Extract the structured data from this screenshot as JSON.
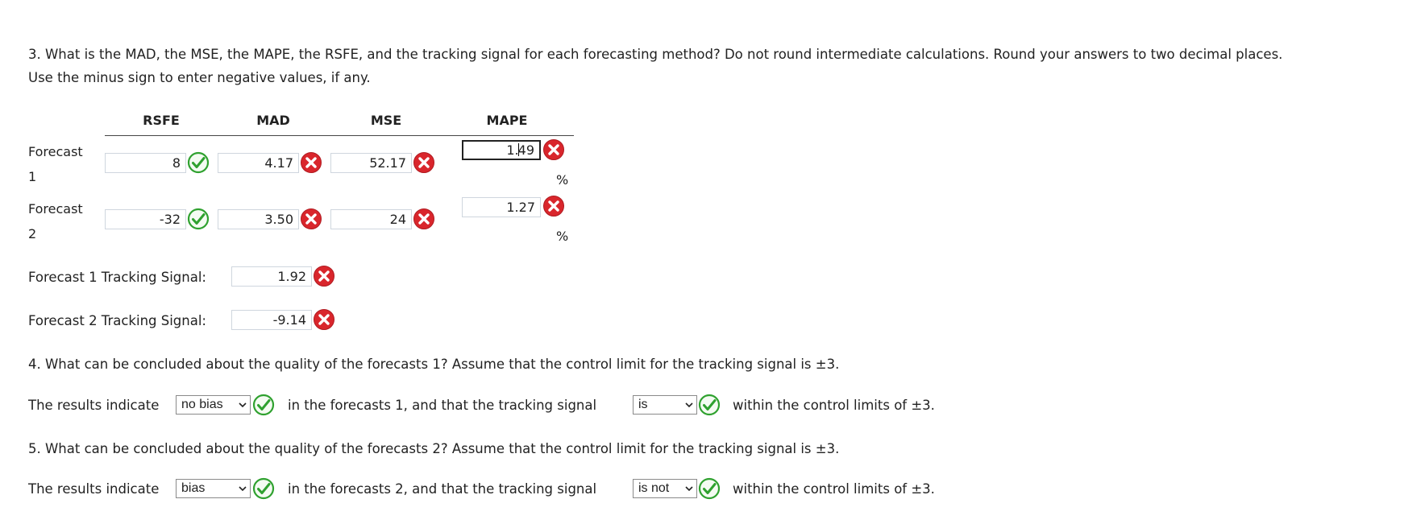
{
  "question3": {
    "line1": "3. What is the MAD, the MSE, the MAPE, the RSFE, and the tracking signal for each forecasting method? Do not round intermediate calculations. Round your answers to two decimal places.",
    "line2": "Use the minus sign to enter negative values, if any."
  },
  "table": {
    "headers": [
      "RSFE",
      "MAD",
      "MSE",
      "MAPE"
    ],
    "rows": [
      {
        "label_line1": "Forecast",
        "label_line2": "1",
        "rsfe": "8",
        "rsfe_status": "correct",
        "mad": "4.17",
        "mad_status": "incorrect",
        "mse": "52.17",
        "mse_status": "incorrect",
        "mape_before_caret": "1.",
        "mape_after_caret": "49",
        "mape_status": "incorrect",
        "pct": "%"
      },
      {
        "label_line1": "Forecast",
        "label_line2": "2",
        "rsfe": "-32",
        "rsfe_status": "correct",
        "mad": "3.50",
        "mad_status": "incorrect",
        "mse": "24",
        "mse_status": "incorrect",
        "mape": "1.27",
        "mape_status": "incorrect",
        "pct": "%"
      }
    ]
  },
  "tracking": {
    "f1_label": "Forecast 1 Tracking Signal:",
    "f1_value": "1.92",
    "f1_status": "incorrect",
    "f2_label": "Forecast 2 Tracking Signal:",
    "f2_value": "-9.14",
    "f2_status": "incorrect"
  },
  "question4": {
    "text": "4. What can be concluded about the quality of the forecasts 1? Assume that the control limit for the tracking signal is ±3.",
    "s_part1": "The results indicate",
    "select1": "no bias",
    "s_part2": "in the forecasts 1, and that the tracking signal",
    "select2": "is",
    "s_part3": "within the control limits of ±3."
  },
  "question5": {
    "text": "5. What can be concluded about the quality of the forecasts 2? Assume that the control limit for the tracking signal is ±3.",
    "s_part1": "The results indicate",
    "select1": "bias",
    "s_part2": "in the forecasts 2, and that the tracking signal",
    "select2": "is not",
    "s_part3": "within the control limits of ±3."
  },
  "colors": {
    "correct_green": "#2fa12f",
    "incorrect_red": "#d9262c"
  }
}
